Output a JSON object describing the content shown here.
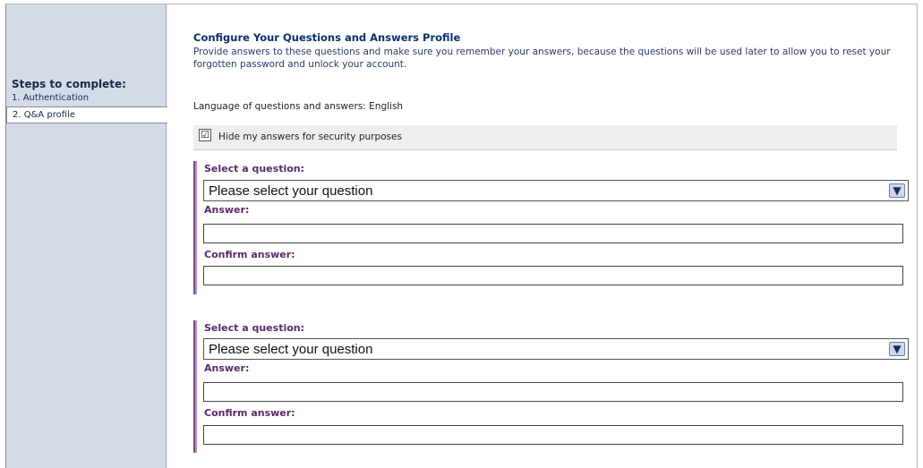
{
  "sidebar": {
    "title": "Steps to complete:",
    "steps": [
      {
        "label": "1. Authentication"
      },
      {
        "label": "2. Q&A profile"
      }
    ]
  },
  "main": {
    "heading": "Configure Your Questions and Answers Profile",
    "intro": "Provide answers to these questions and make sure you remember your answers, because the questions will be used later to allow you to reset your forgotten password and unlock your account.",
    "language_label": "Language of questions and answers:",
    "language_value": "English",
    "hide_answers": {
      "label": "Hide my answers for security purposes",
      "checked": true,
      "check_glyph": "☑"
    },
    "questions": [
      {
        "select_label": "Select a question:",
        "select_value": "Please select your question",
        "answer_label": "Answer:",
        "answer_value": "",
        "confirm_label": "Confirm answer:",
        "confirm_value": ""
      },
      {
        "select_label": "Select a question:",
        "select_value": "Please select your question",
        "answer_label": "Answer:",
        "answer_value": "",
        "confirm_label": "Confirm answer:",
        "confirm_value": ""
      }
    ]
  },
  "icons": {
    "dropdown": "chevron-down-icon",
    "checkbox": "check-icon"
  }
}
